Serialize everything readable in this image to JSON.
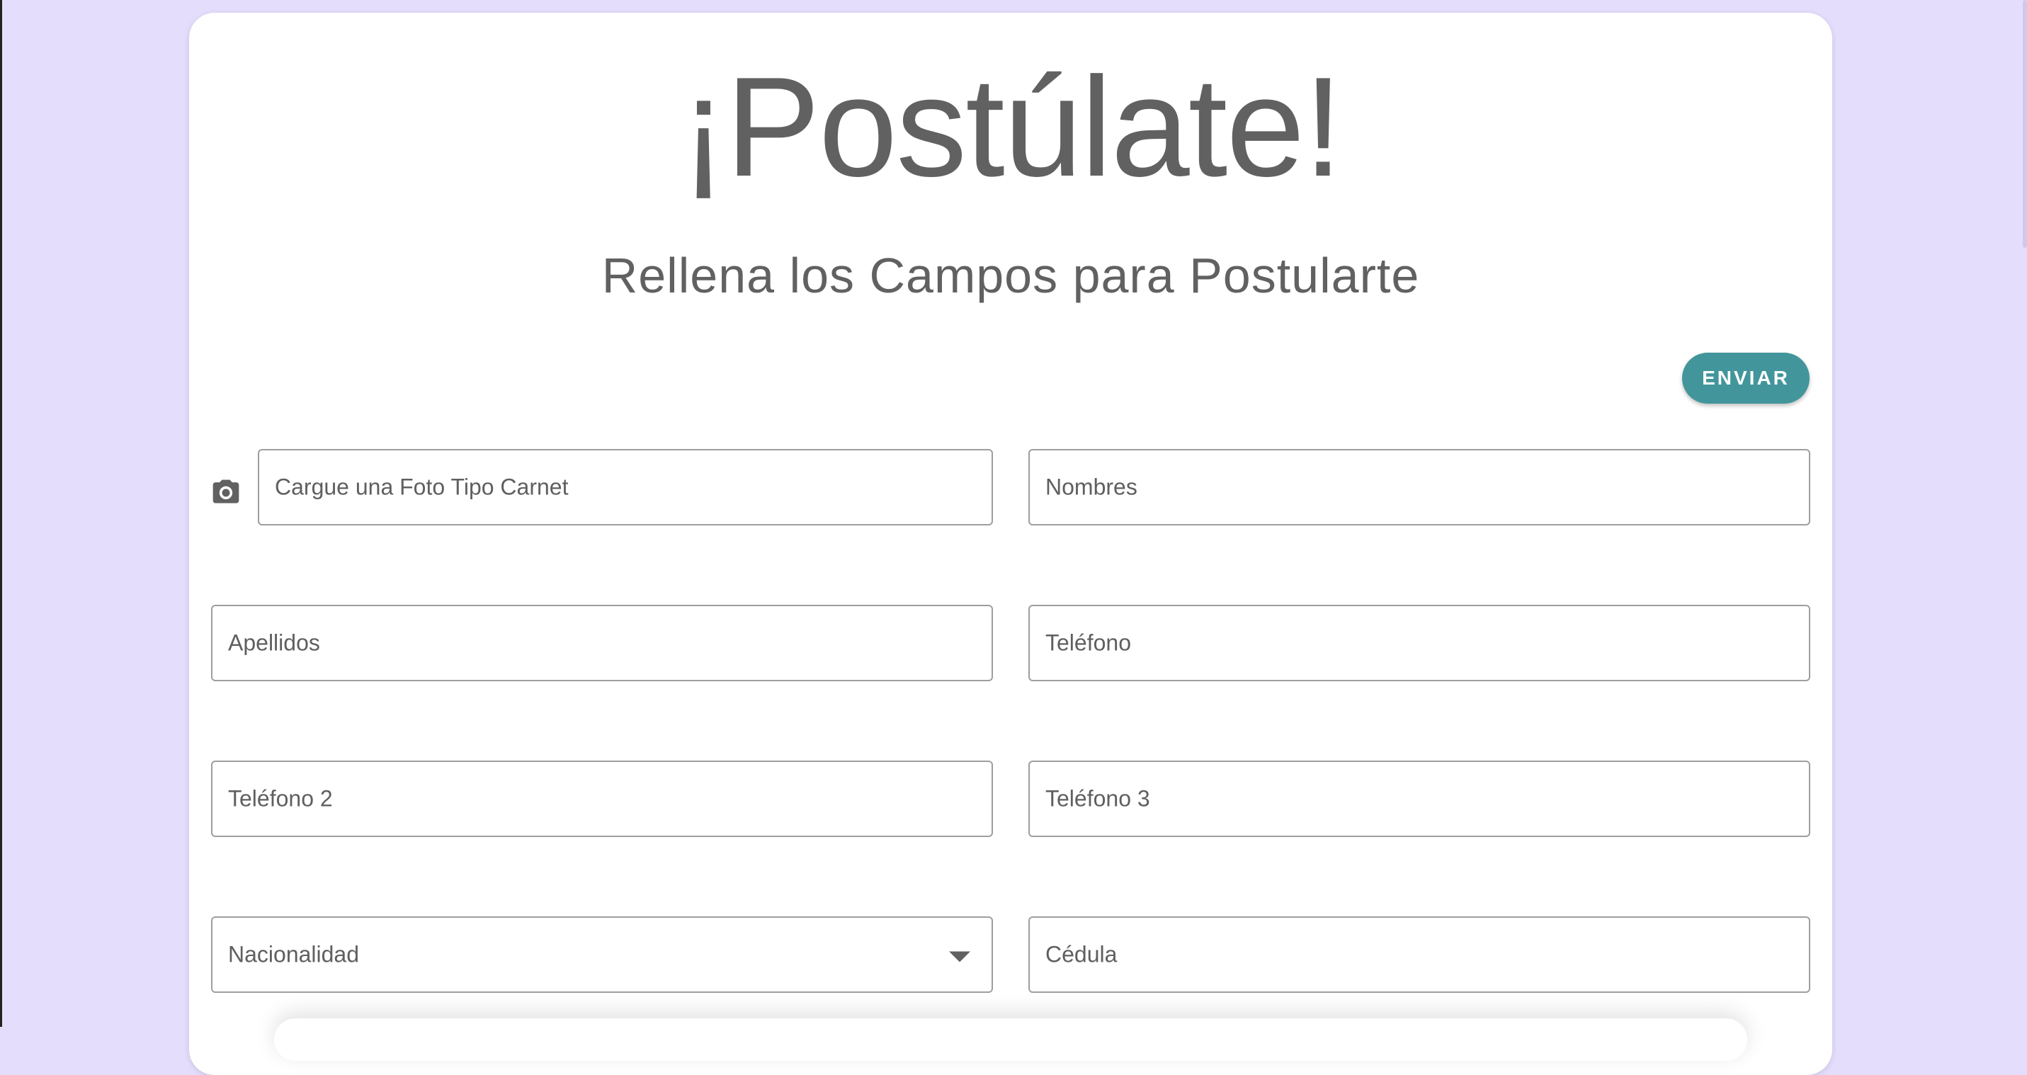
{
  "header": {
    "title": "¡Postúlate!",
    "subtitle": "Rellena los Campos para Postularte"
  },
  "actions": {
    "send_label": "ENVIAR"
  },
  "form": {
    "photo": "Cargue una Foto Tipo Carnet",
    "nombres": "Nombres",
    "apellidos": "Apellidos",
    "telefono": "Teléfono",
    "telefono2": "Teléfono 2",
    "telefono3": "Teléfono 3",
    "nacionalidad": "Nacionalidad",
    "cedula": "Cédula"
  },
  "icons": {
    "photo": "camera-icon",
    "nacionalidad": "chevron-down-icon"
  },
  "colors": {
    "background": "#e4ddfc",
    "accent": "#42969b",
    "text": "#616161"
  }
}
